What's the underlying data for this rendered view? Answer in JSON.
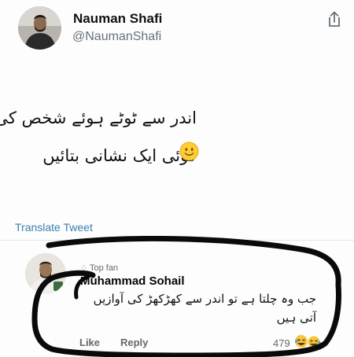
{
  "tweet": {
    "author": {
      "display_name": "Nauman Shafi",
      "handle": "@NaumanShafi",
      "avatar_icon": "profile-photo"
    },
    "share_icon": "share-icon",
    "text_lines": [
      "اندر سے ٹوٹے ہوئے شخص کی",
      "کوئی ایک نشانی بتائیں"
    ],
    "emoji_icon": "slightly-smiling-face-icon",
    "translate_label": "Translate Tweet"
  },
  "comment": {
    "badge": "Top fan",
    "author": "Muhammad Sohail",
    "text_lines": [
      "جب وہ چلتا ہے تو اندر سے کھڑکھڑ کی آوازیں",
      "آتی ہیں"
    ],
    "like_label": "Like",
    "reply_label": "Reply",
    "reaction_count": "479",
    "reaction_icons": [
      "laughing-face-icon",
      "laughing-face-icon"
    ]
  },
  "colors": {
    "link": "#3a7fae",
    "muted": "#65676b",
    "highlight_ink": "#0a0a0a"
  }
}
